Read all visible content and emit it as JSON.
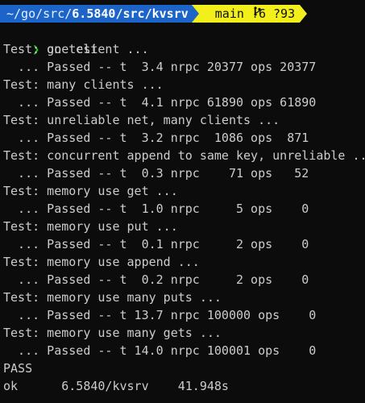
{
  "prompt": {
    "path_prefix": "~/go/src/",
    "path_dir": "6.5840",
    "path_sep1": "/",
    "path_src": "src",
    "path_sep2": "/",
    "path_repo": "kvsrv",
    "branch": "main",
    "status": "!6 ?93",
    "branch_icon": "branch-icon"
  },
  "command": {
    "symbol": "❯",
    "text": " go test"
  },
  "output_lines": [
    "Test: one client ...",
    "  ... Passed -- t  3.4 nrpc 20377 ops 20377",
    "Test: many clients ...",
    "  ... Passed -- t  4.1 nrpc 61890 ops 61890",
    "Test: unreliable net, many clients ...",
    "  ... Passed -- t  3.2 nrpc  1086 ops  871",
    "Test: concurrent append to same key, unreliable ...",
    "  ... Passed -- t  0.3 nrpc    71 ops   52",
    "Test: memory use get ...",
    "  ... Passed -- t  1.0 nrpc     5 ops    0",
    "Test: memory use put ...",
    "  ... Passed -- t  0.1 nrpc     2 ops    0",
    "Test: memory use append ...",
    "  ... Passed -- t  0.2 nrpc     2 ops    0",
    "Test: memory use many puts ...",
    "  ... Passed -- t 13.7 nrpc 100000 ops    0",
    "Test: memory use many gets ...",
    "  ... Passed -- t 14.0 nrpc 100001 ops    0",
    "PASS",
    "ok      6.5840/kvsrv    41.948s"
  ],
  "colors": {
    "background": "#0c0c0c",
    "text": "#cccccc",
    "path_bg": "#1d64c9",
    "git_bg": "#f2ef1b",
    "prompt_symbol": "#16c60c"
  }
}
